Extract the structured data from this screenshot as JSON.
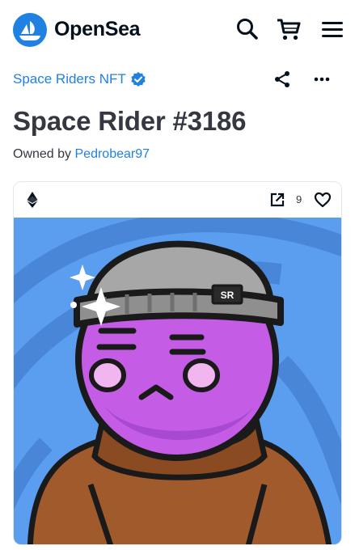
{
  "header": {
    "brand": "OpenSea",
    "icons": [
      "opensea-logo-icon",
      "search-icon",
      "cart-icon",
      "menu-icon"
    ]
  },
  "collection": {
    "name": "Space Riders NFT",
    "verified": true
  },
  "item": {
    "title": "Space Rider #3186",
    "owned_prefix": "Owned by",
    "owner": "Pedrobear97"
  },
  "card": {
    "chain_icon": "ethereum-icon",
    "favorites": "9",
    "hat_patch": "SR"
  },
  "colors": {
    "accent": "#2081e2",
    "art_background": "#5b9ef0",
    "face": "#c45ce6",
    "sweater": "#a15a2c",
    "beanie": "#a7a7a7"
  }
}
